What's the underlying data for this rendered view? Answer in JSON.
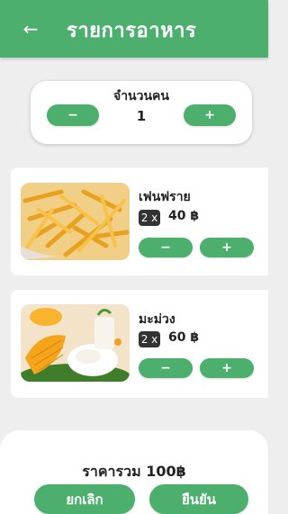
{
  "header": {
    "title": "รายการอาหาร",
    "back_icon": "←"
  },
  "people": {
    "label": "จำนวนคน",
    "value": "1",
    "minus": "−",
    "plus": "+"
  },
  "items": [
    {
      "name": "เฟนฟราย",
      "qty": "2 x",
      "price": "40 ฿",
      "minus": "−",
      "plus": "+"
    },
    {
      "name": "มะม่วง",
      "qty": "2 x",
      "price": "60 ฿",
      "minus": "−",
      "plus": "+"
    }
  ],
  "footer": {
    "total": "ราคารวม 100฿",
    "cancel": "ยกเลิก",
    "confirm": "ยืนยัน"
  },
  "colors": {
    "accent": "#4caf6e",
    "background": "#eeeeee"
  }
}
